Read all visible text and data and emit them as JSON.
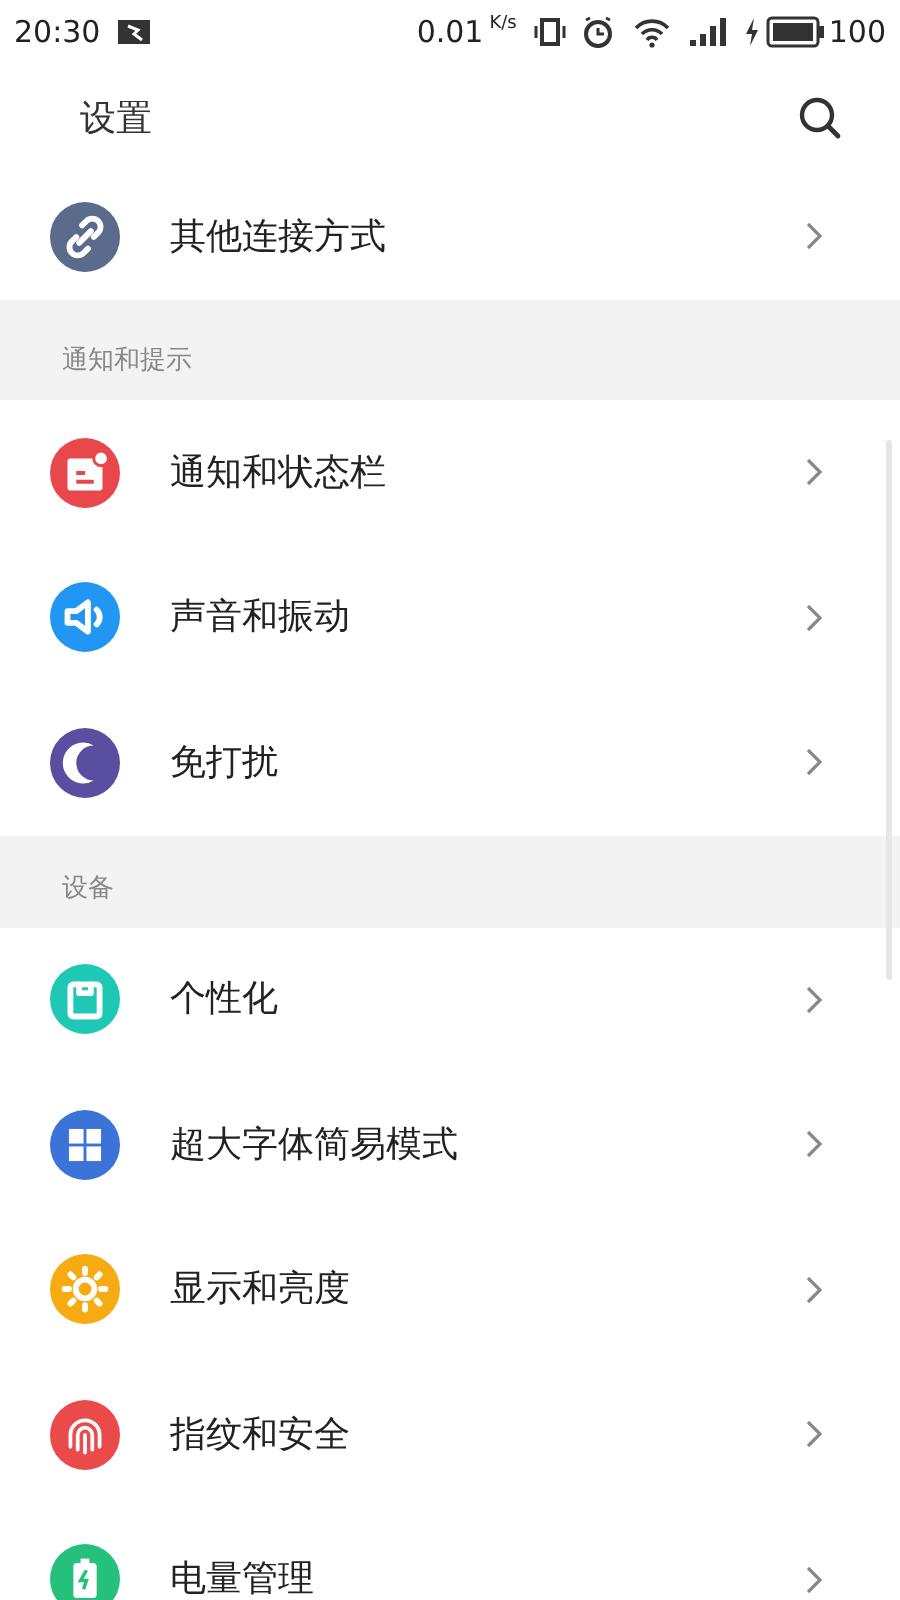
{
  "status_bar": {
    "time": "20:30",
    "speed": "0.01",
    "speed_unit": "K/s",
    "battery": "100"
  },
  "header": {
    "title": "设置"
  },
  "groups": [
    {
      "items": [
        {
          "kind": "link",
          "label": "其他连接方式",
          "color": "#5b6b8c"
        }
      ]
    },
    {
      "title": "通知和提示",
      "items": [
        {
          "kind": "notification",
          "label": "通知和状态栏",
          "color": "#e8484c"
        },
        {
          "kind": "sound",
          "label": "声音和振动",
          "color": "#2196f3"
        },
        {
          "kind": "moon",
          "label": "免打扰",
          "color": "#5a4ea0"
        }
      ]
    },
    {
      "title": "设备",
      "items": [
        {
          "kind": "shirt",
          "label": "个性化",
          "color": "#1fc7b5"
        },
        {
          "kind": "grid",
          "label": "超大字体简易模式",
          "color": "#3b73d9"
        },
        {
          "kind": "sun",
          "label": "显示和亮度",
          "color": "#f6ab13"
        },
        {
          "kind": "fingerprint",
          "label": "指纹和安全",
          "color": "#ea4a4a"
        },
        {
          "kind": "battery",
          "label": "电量管理",
          "color": "#25c07b"
        }
      ]
    }
  ]
}
